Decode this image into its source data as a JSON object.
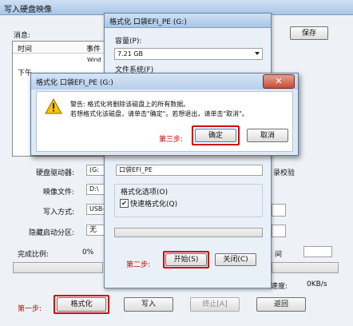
{
  "main": {
    "title": "写入硬盘映像",
    "message_label": "消息:",
    "save_button": "保存",
    "table_headers": [
      "时间",
      "事件"
    ],
    "row_time": "下午",
    "row_event": "Wind",
    "disk_drive_label": "硬盘驱动器:",
    "disk_drive_value": "(G:",
    "verify_label": "录校验",
    "image_file_label": "映像文件:",
    "image_file_value": "D:\\",
    "write_mode_label": "写入方式:",
    "write_mode_value": "USB-",
    "hidden_partition_label": "隐藏启动分区:",
    "hidden_partition_value": "无",
    "complete_ratio_label": "完成比例:",
    "complete_ratio_value": "0%",
    "time_suffix": "间",
    "speed_suffix": "速度:",
    "speed_value": "0KB/s",
    "step1_label": "第一步:",
    "format_button": "格式化",
    "write_button": "写入",
    "stop_button": "终止[A]",
    "back_button": "返回"
  },
  "format_dialog": {
    "title": "格式化 口袋EFI_PE (G:)",
    "capacity_label": "容量(P):",
    "capacity_value": "7.21 GB",
    "filesystem_label": "文件系统(F)",
    "volume_label_value": "口袋EFI_PE",
    "options_label": "格式化选项(O)",
    "quick_format_label": "快速格式化(Q)",
    "quick_format_checked": true,
    "step2_label": "第二步:",
    "start_button": "开始(S)",
    "close_button": "关闭(C)"
  },
  "confirm_dialog": {
    "title": "格式化 口袋EFI_PE (G:)",
    "warning_line1": "警告: 格式化将删除该磁盘上的所有数据。",
    "warning_line2": "若想格式化该磁盘，请单击\"确定\"。若想退出，请单击\"取消\"。",
    "step3_label": "第三步:",
    "ok_button": "确定",
    "cancel_button": "取消",
    "close_glyph": "✕"
  },
  "colors": {
    "accent_red": "#d00000",
    "titlebar": "#b9d1ea"
  }
}
